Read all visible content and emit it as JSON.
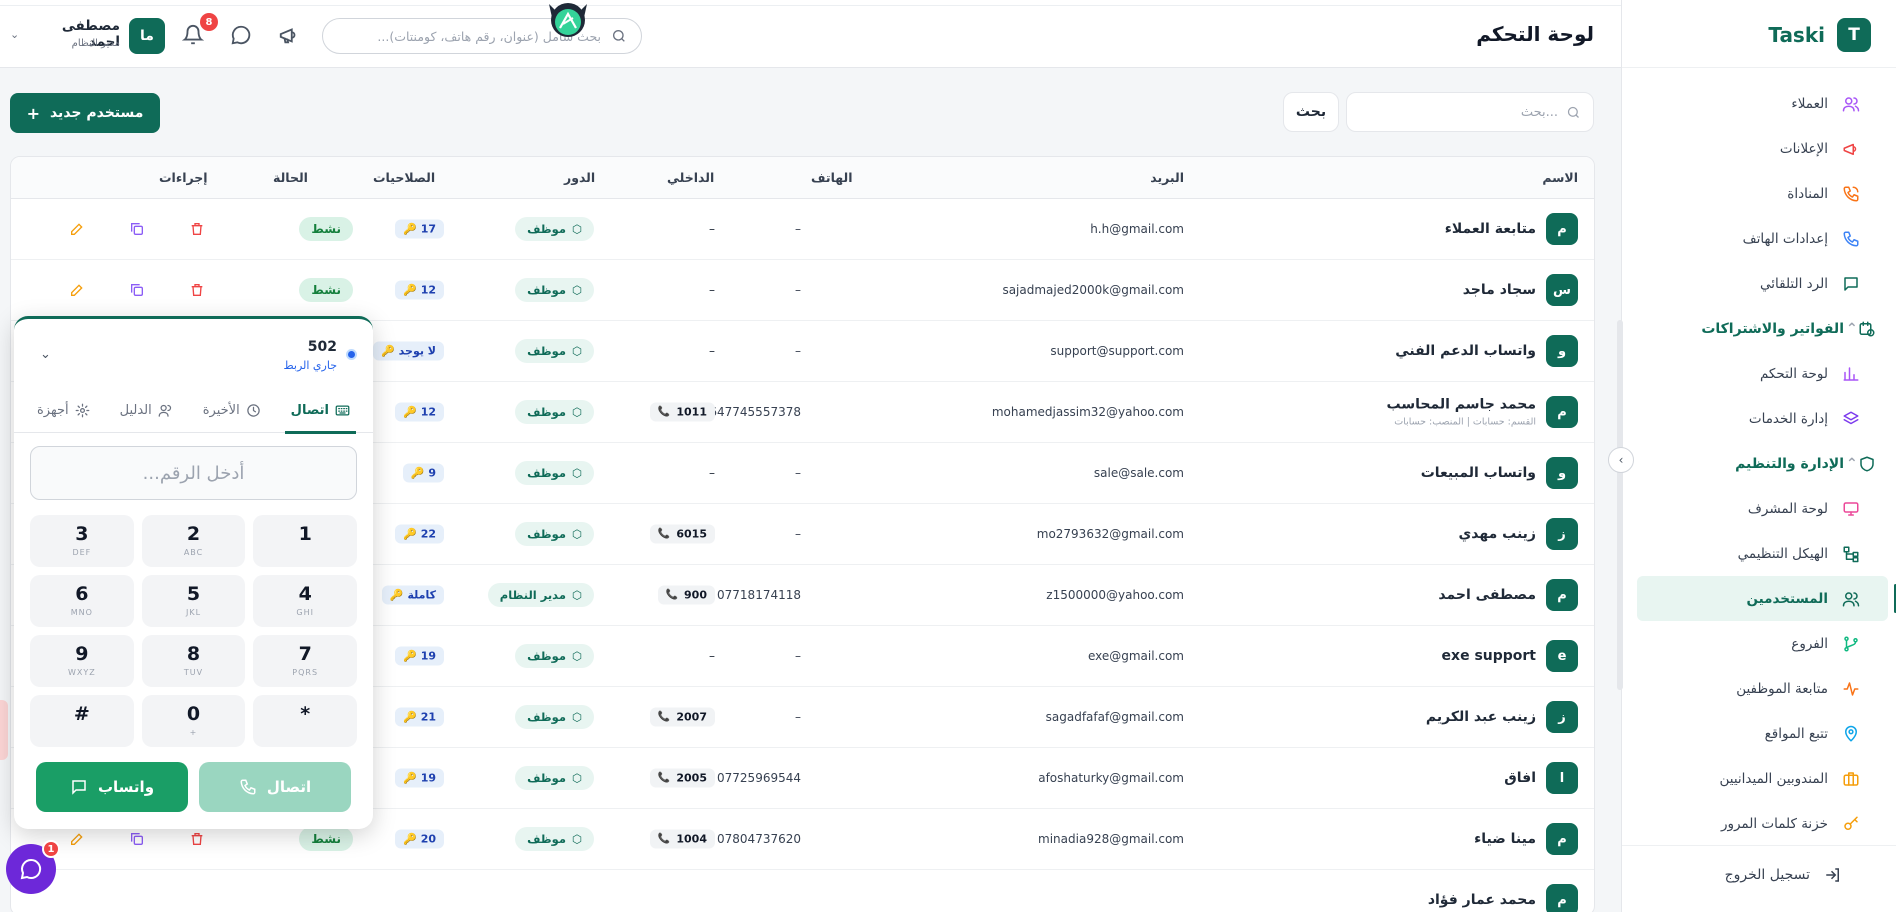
{
  "brand": {
    "logo_letter": "T",
    "name": "Taski"
  },
  "header": {
    "title": "لوحة التحكم",
    "search_placeholder": "بحث شامل (عنوان، رقم هاتف، كومنتات)...",
    "notifications_count": "8",
    "user": {
      "initials": "ما",
      "name": "مصطفى احمد",
      "role": "مدير النظام"
    }
  },
  "sidebar": {
    "items": [
      {
        "label": "العملاء",
        "icon": "users-icon",
        "color": "#a855f7"
      },
      {
        "label": "الإعلانات",
        "icon": "megaphone-icon",
        "color": "#ef4444"
      },
      {
        "label": "المناداة",
        "icon": "phone-ring-icon",
        "color": "#f97316"
      },
      {
        "label": "إعدادات الهاتف",
        "icon": "phone-icon",
        "color": "#3b82f6"
      },
      {
        "label": "الرد التلقائي",
        "icon": "message-icon",
        "color": "#0f6b58"
      },
      {
        "label": "الفواتير والاشتراكات",
        "icon": "calendar-clock-icon",
        "color": "#0f6b58",
        "section": true
      },
      {
        "label": "لوحة التحكم",
        "icon": "bar-chart-icon",
        "color": "#a855f7"
      },
      {
        "label": "إدارة الخدمات",
        "icon": "layers-icon",
        "color": "#7c3aed"
      },
      {
        "label": "الإدارة والتنظيم",
        "icon": "shield-icon",
        "color": "#0f6b58",
        "section": true
      },
      {
        "label": "لوحة المشرف",
        "icon": "monitor-icon",
        "color": "#ec4899"
      },
      {
        "label": "الهيكل التنظيمي",
        "icon": "hierarchy-icon",
        "color": "#0f6b58"
      },
      {
        "label": "المستخدمين",
        "icon": "users-icon",
        "color": "#0f6b58",
        "active": true
      },
      {
        "label": "الفروع",
        "icon": "branch-icon",
        "color": "#10b981"
      },
      {
        "label": "متابعة الموظفين",
        "icon": "activity-icon",
        "color": "#f97316"
      },
      {
        "label": "تتبع المواقع",
        "icon": "map-pin-icon",
        "color": "#0ea5e9"
      },
      {
        "label": "المندوبين الميدانيين",
        "icon": "briefcase-icon",
        "color": "#f59e0b"
      },
      {
        "label": "خزنة كلمات المرور",
        "icon": "key-icon",
        "color": "#f59e0b"
      }
    ],
    "logout": "تسجيل الخروج"
  },
  "toolbar": {
    "new_user": "مستخدم جديد",
    "search_placeholder": "بحث...",
    "search_button": "بحث"
  },
  "table": {
    "headers": {
      "name": "الاسم",
      "email": "البريد",
      "phone": "الهاتف",
      "ext": "الداخلي",
      "role": "الدور",
      "perms": "الصلاحيات",
      "status": "الحالة",
      "actions": "إجراءات"
    },
    "rows": [
      {
        "initial": "م",
        "name": "متابعة العملاء",
        "sub": "",
        "email": "h.h@gmail.com",
        "phone": "–",
        "ext": "–",
        "role": "موظف",
        "perms": "17",
        "status": "نشط"
      },
      {
        "initial": "س",
        "name": "سجاد ماجد",
        "sub": "",
        "email": "sajadmajed2000k@gmail.com",
        "phone": "–",
        "ext": "–",
        "role": "موظف",
        "perms": "12",
        "status": "نشط"
      },
      {
        "initial": "و",
        "name": "واتساب الدعم الفني",
        "sub": "",
        "email": "support@support.com",
        "phone": "–",
        "ext": "–",
        "role": "موظف",
        "perms": "لا يوجد",
        "status": ""
      },
      {
        "initial": "م",
        "name": "محمد جاسم المحاسب",
        "sub": "القسم: حسابات | المنصب: حسابات",
        "email": "mohamedjassim32@yahoo.com",
        "phone": "9647745557378",
        "ext": "1011",
        "role": "موظف",
        "perms": "12",
        "status": ""
      },
      {
        "initial": "و",
        "name": "واتساب المبيعات",
        "sub": "",
        "email": "sale@sale.com",
        "phone": "–",
        "ext": "–",
        "role": "موظف",
        "perms": "9",
        "status": ""
      },
      {
        "initial": "ز",
        "name": "زينب مهدي",
        "sub": "",
        "email": "mo2793632@gmail.com",
        "phone": "–",
        "ext": "6015",
        "role": "موظف",
        "perms": "22",
        "status": ""
      },
      {
        "initial": "م",
        "name": "مصطفى احمد",
        "sub": "",
        "email": "z1500000@yahoo.com",
        "phone": "07718174118",
        "ext": "900",
        "role": "مدير النظام",
        "perms": "كاملة",
        "status": ""
      },
      {
        "initial": "e",
        "name": "exe support",
        "sub": "",
        "email": "exe@gmail.com",
        "phone": "–",
        "ext": "–",
        "role": "موظف",
        "perms": "19",
        "status": ""
      },
      {
        "initial": "ز",
        "name": "زينب عبد الكريم",
        "sub": "",
        "email": "sagadfafaf@gmail.com",
        "phone": "–",
        "ext": "2007",
        "role": "موظف",
        "perms": "21",
        "status": ""
      },
      {
        "initial": "ا",
        "name": "افاق",
        "sub": "",
        "email": "afoshaturky@gmail.com",
        "phone": "07725969544",
        "ext": "2005",
        "role": "موظف",
        "perms": "19",
        "status": ""
      },
      {
        "initial": "م",
        "name": "مينا ضياء",
        "sub": "",
        "email": "minadia928@gmail.com",
        "phone": "07804737620",
        "ext": "1004",
        "role": "موظف",
        "perms": "20",
        "status": "نشط"
      },
      {
        "initial": "م",
        "name": "محمد عمار فؤاد",
        "sub": "",
        "email": "",
        "phone": "",
        "ext": "",
        "role": "",
        "perms": "",
        "status": ""
      }
    ]
  },
  "dialer": {
    "extension": "502",
    "status": "جاري الربط",
    "tabs": [
      {
        "label": "اتصال",
        "icon": "keypad-icon",
        "active": true
      },
      {
        "label": "الأخيرة",
        "icon": "clock-icon"
      },
      {
        "label": "الدليل",
        "icon": "contacts-icon"
      },
      {
        "label": "أجهزة",
        "icon": "gear-icon"
      }
    ],
    "input_placeholder": "أدخل الرقم...",
    "keys": [
      {
        "d": "1",
        "l": ""
      },
      {
        "d": "2",
        "l": "ABC"
      },
      {
        "d": "3",
        "l": "DEF"
      },
      {
        "d": "4",
        "l": "GHI"
      },
      {
        "d": "5",
        "l": "JKL"
      },
      {
        "d": "6",
        "l": "MNO"
      },
      {
        "d": "7",
        "l": "PQRS"
      },
      {
        "d": "8",
        "l": "TUV"
      },
      {
        "d": "9",
        "l": "WXYZ"
      },
      {
        "d": "*",
        "l": ""
      },
      {
        "d": "0",
        "l": "+"
      },
      {
        "d": "#",
        "l": ""
      }
    ],
    "call_label": "اتصال",
    "whatsapp_label": "واتساب"
  },
  "chat": {
    "badge": "1"
  }
}
